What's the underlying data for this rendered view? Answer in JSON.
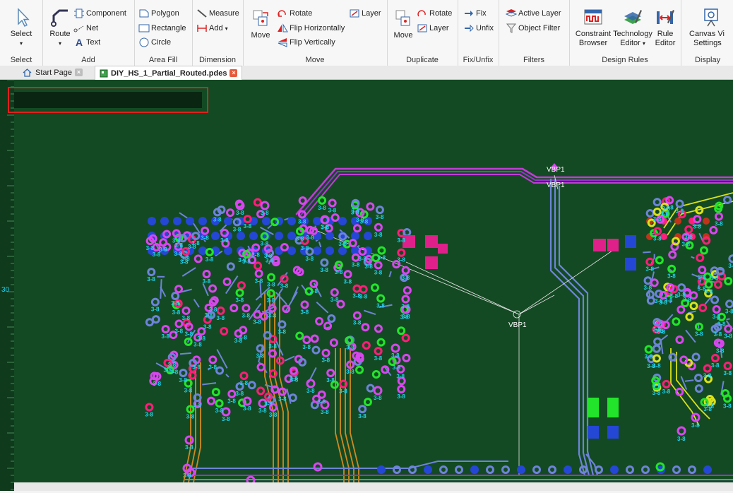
{
  "ribbon": {
    "select": {
      "label": "Select",
      "group": "Select"
    },
    "add": {
      "route": "Route",
      "component": "Component",
      "net": "Net",
      "text": "Text",
      "group": "Add"
    },
    "area_fill": {
      "polygon": "Polygon",
      "rectangle": "Rectangle",
      "circle": "Circle",
      "group": "Area Fill"
    },
    "dimension": {
      "measure": "Measure",
      "add": "Add",
      "group": "Dimension"
    },
    "move": {
      "move": "Move",
      "rotate": "Rotate",
      "layer": "Layer",
      "flip_h": "Flip Horizontally",
      "flip_v": "Flip Vertically",
      "group": "Move"
    },
    "duplicate": {
      "move": "Move",
      "rotate": "Rotate",
      "layer": "Layer",
      "group": "Duplicate"
    },
    "fix": {
      "fix": "Fix",
      "unfix": "Unfix",
      "group": "Fix/Unfix"
    },
    "filters": {
      "active_layer": "Active Layer",
      "object_filter": "Object Filter",
      "group": "Filters"
    },
    "design_rules": {
      "constraint_l1": "Constraint",
      "constraint_l2": "Browser",
      "tech_l1": "Technology",
      "tech_l2": "Editor",
      "rule_l1": "Rule",
      "rule_l2": "Editor",
      "group": "Design Rules"
    },
    "display": {
      "canvas_l1": "Canvas Vi",
      "canvas_l2": "Settings",
      "group": "Display"
    }
  },
  "tabs": [
    {
      "label": "Start Page",
      "active": false
    },
    {
      "label": "DIY_HS_1_Partial_Routed.pdes",
      "active": true
    }
  ],
  "ruler": {
    "mark": "30"
  },
  "canvas": {
    "net_label_top": "VBP1",
    "net_label_mid": "VBP1",
    "net_label_center": "VBP1",
    "net_label_small": "3-8",
    "colors": {
      "board": "#144a23",
      "via_label": "#22d3ee",
      "magenta": "#d946ef",
      "green": "#22e52b",
      "blue": "#2547d6",
      "orange": "#d08a20",
      "pink": "#ff1e7a",
      "trace_blue": "#6d84d8",
      "trace_purple": "#9b30d6"
    }
  }
}
